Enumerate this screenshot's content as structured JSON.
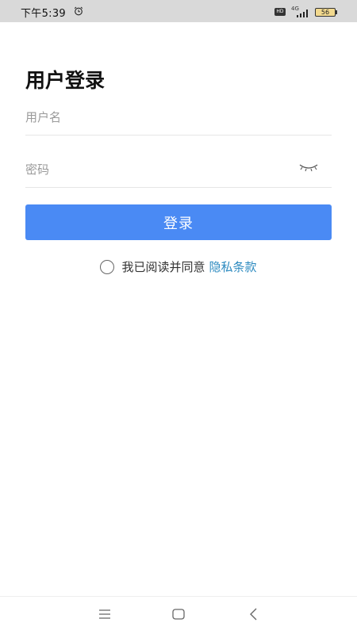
{
  "status_bar": {
    "time": "下午5:39",
    "network_type": "4G",
    "hd_label": "HD",
    "battery_level": "56"
  },
  "login": {
    "title": "用户登录",
    "username_placeholder": "用户名",
    "password_placeholder": "密码",
    "login_button": "登录",
    "agreement_text": "我已阅读并同意",
    "privacy_link": "隐私条款"
  },
  "colors": {
    "primary_button": "#4a8af4",
    "link": "#2e8bc0"
  },
  "icons": {
    "alarm": "alarm-clock-icon",
    "signal": "signal-strength-icon",
    "password_toggle": "eye-closed-icon",
    "nav_menu": "menu-icon",
    "nav_home": "home-icon",
    "nav_back": "back-icon"
  }
}
